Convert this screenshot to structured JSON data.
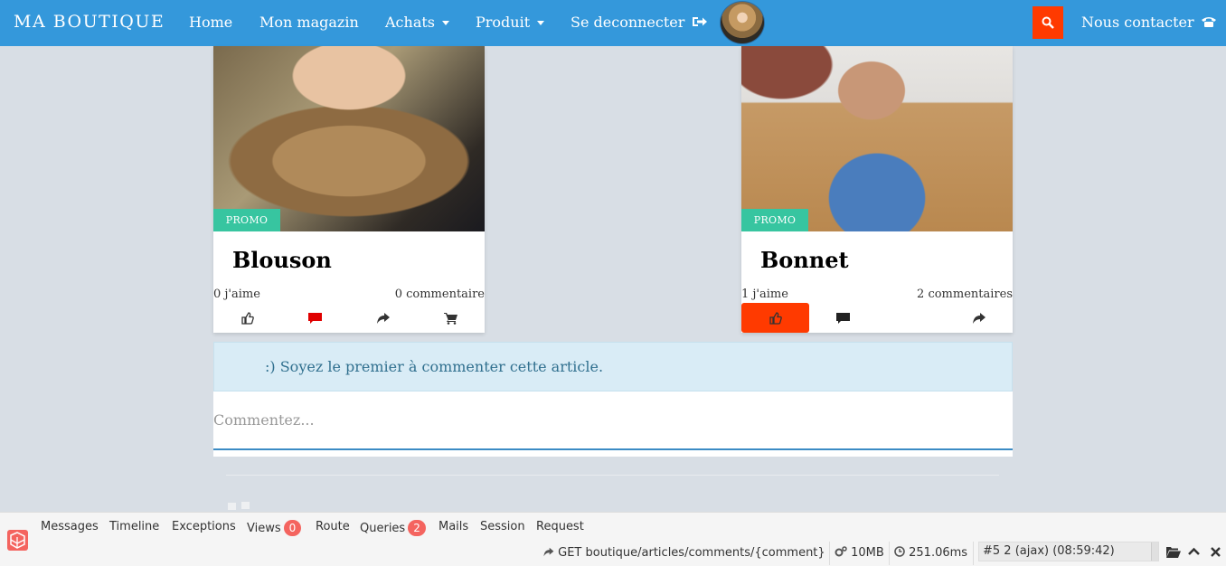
{
  "navbar": {
    "brand": "MA BOUTIQUE",
    "items": [
      {
        "label": "Home"
      },
      {
        "label": "Mon magazin"
      },
      {
        "label": "Achats"
      },
      {
        "label": "Produit"
      },
      {
        "label": "Se deconnecter"
      }
    ],
    "contact": "Nous contacter",
    "accent": "#3498db",
    "search_color": "#ff3a00"
  },
  "products": [
    {
      "badge": "PROMO",
      "title": "Blouson",
      "likes": "0 j'aime",
      "comments": "0 commentaire"
    },
    {
      "badge": "PROMO",
      "title": "Bonnet",
      "likes": "1 j'aime",
      "comments": "2 commentaires"
    }
  ],
  "comment_section": {
    "info": ":)  Soyez le premier à commenter cette article.",
    "placeholder": "Commentez..."
  },
  "debugbar": {
    "tabs": [
      "Messages",
      "Timeline",
      "Exceptions",
      "Views",
      "Route",
      "Queries",
      "Mails",
      "Session",
      "Request"
    ],
    "views_count": "0",
    "queries_count": "2",
    "request": "GET boutique/articles/comments/{comment}",
    "memory": "10MB",
    "time": "251.06ms",
    "selected_request": "#5 2 (ajax) (08:59:42)"
  }
}
